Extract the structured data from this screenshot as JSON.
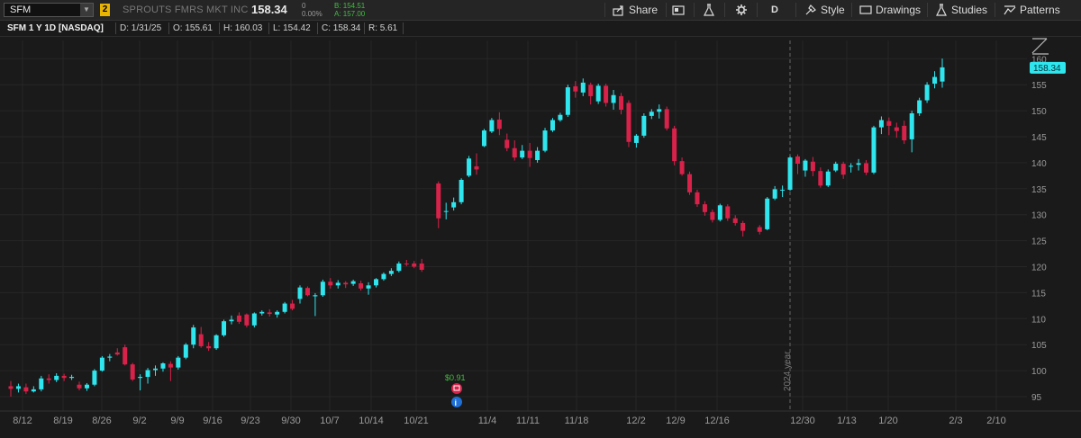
{
  "toolbar": {
    "symbol": "SFM",
    "link_badge": "2",
    "company": "SPROUTS FMRS MKT INC",
    "last_price": "158.34",
    "net_change": "0",
    "pct_change": "0.00%",
    "bid": "B: 154.51",
    "ask": "A: 157.00",
    "share_label": "Share",
    "aggregation_label": "D",
    "style_label": "Style",
    "drawings_label": "Drawings",
    "studies_label": "Studies",
    "patterns_label": "Patterns",
    "icons": [
      "share-icon",
      "snapshot-icon",
      "flask-icon",
      "gear-icon",
      "style-icon",
      "drawings-icon",
      "studies-icon",
      "patterns-icon"
    ]
  },
  "infobar": {
    "title": "SFM 1 Y 1D [NASDAQ]",
    "date": "D: 1/31/25",
    "open": "O: 155.61",
    "high": "H: 160.03",
    "low": "L: 154.42",
    "close": "C: 158.34",
    "range": "R: 5.61"
  },
  "chart_data": {
    "type": "candlestick",
    "y_ticks": [
      "160",
      "155",
      "150",
      "145",
      "140",
      "135",
      "130",
      "125",
      "120",
      "115",
      "110",
      "105",
      "100",
      "95"
    ],
    "ylim": [
      92,
      162
    ],
    "x_ticks": [
      "8/12",
      "8/19",
      "8/26",
      "9/2",
      "9/9",
      "9/16",
      "9/23",
      "9/30",
      "10/7",
      "10/14",
      "10/21",
      "11/4",
      "11/11",
      "11/18",
      "12/2",
      "12/9",
      "12/16",
      "12/30",
      "1/13",
      "1/20",
      "2/3",
      "2/10"
    ],
    "price_label": "158.34",
    "year_marker": "2024 year",
    "dividend_label": "$0.91",
    "colors": {
      "up": "#2fe6ee",
      "down": "#d9224a",
      "grid": "#262626",
      "axis_text": "#9a9a9a",
      "price_tag": "#2fe6ee"
    },
    "candles": [
      [
        97,
        98,
        95,
        96.5
      ],
      [
        96.5,
        97.5,
        95.8,
        97
      ],
      [
        96.8,
        97.5,
        95.5,
        96
      ],
      [
        96,
        97,
        95.8,
        96.4
      ],
      [
        96.4,
        99,
        96,
        98.5
      ],
      [
        98.5,
        99.3,
        97.5,
        98.2
      ],
      [
        98.2,
        99.5,
        97.8,
        99
      ],
      [
        99,
        99.4,
        98,
        98.6
      ],
      [
        98.6,
        99.2,
        98.2,
        98.8
      ],
      [
        97.3,
        97.9,
        96.2,
        96.6
      ],
      [
        96.6,
        97.6,
        96.1,
        97.3
      ],
      [
        97.3,
        100.3,
        97,
        100
      ],
      [
        100,
        102.8,
        99.8,
        102.5
      ],
      [
        102.5,
        103.2,
        101.8,
        102.7
      ],
      [
        103.5,
        104.3,
        102.9,
        103.1
      ],
      [
        104.5,
        105,
        101,
        101.2
      ],
      [
        101.2,
        101.5,
        98,
        98.3
      ],
      [
        98.6,
        99.3,
        96.2,
        98.8
      ],
      [
        98.8,
        100.5,
        97.5,
        100.1
      ],
      [
        100.1,
        101,
        99,
        100.4
      ],
      [
        100.4,
        101.6,
        99.8,
        101.4
      ],
      [
        101.3,
        101.8,
        98,
        100.6
      ],
      [
        100.6,
        102.8,
        100.2,
        102.5
      ],
      [
        102.5,
        105.3,
        102.2,
        105
      ],
      [
        105,
        108.8,
        104.3,
        108.3
      ],
      [
        107,
        108.4,
        104.4,
        104.7
      ],
      [
        104.7,
        105.5,
        103.8,
        104.3
      ],
      [
        104.3,
        107,
        104,
        106.8
      ],
      [
        106.8,
        109.8,
        106.5,
        109.5
      ],
      [
        109.5,
        110.6,
        108.9,
        109.8
      ],
      [
        110.6,
        111.2,
        109,
        109.4
      ],
      [
        110.8,
        111,
        108.3,
        108.7
      ],
      [
        108.7,
        111.2,
        108.3,
        111
      ],
      [
        111,
        111.6,
        110.6,
        111.3
      ],
      [
        111.2,
        111.8,
        110.4,
        110.9
      ],
      [
        110.8,
        111.6,
        110.2,
        111.3
      ],
      [
        111.3,
        113.2,
        111,
        112.9
      ],
      [
        112.9,
        113.6,
        111.6,
        111.9
      ],
      [
        113.8,
        116.4,
        112.9,
        116
      ],
      [
        115.9,
        116.2,
        114.3,
        114.5
      ],
      [
        114.3,
        114.9,
        110.5,
        114.5
      ],
      [
        114.5,
        117.5,
        114.2,
        117.1
      ],
      [
        117.1,
        117.8,
        115.8,
        116.4
      ],
      [
        116.4,
        117.4,
        115.8,
        116.9
      ],
      [
        116.9,
        117.2,
        115.9,
        116.6
      ],
      [
        116.7,
        117.5,
        116.3,
        117.2
      ],
      [
        116.8,
        117.3,
        115.4,
        115.8
      ],
      [
        115.8,
        117,
        114.6,
        116.4
      ],
      [
        116.4,
        117.8,
        116,
        117.6
      ],
      [
        117.6,
        118.9,
        117.3,
        118.6
      ],
      [
        118.6,
        119.7,
        118.2,
        119.2
      ],
      [
        119.2,
        121,
        118.9,
        120.6
      ],
      [
        120.6,
        121.3,
        120.1,
        120.5
      ],
      [
        120.6,
        121.1,
        119.7,
        120
      ],
      [
        120.6,
        121.5,
        119,
        119.4
      ],
      [
        136,
        136.4,
        127.4,
        129.3
      ],
      [
        130.7,
        132.3,
        129.1,
        130.7
      ],
      [
        131.4,
        133.3,
        130.8,
        132.4
      ],
      [
        132.4,
        137,
        132,
        136.7
      ],
      [
        137.5,
        141.3,
        137.2,
        140.8
      ],
      [
        139.3,
        141.8,
        137.7,
        138.7
      ],
      [
        143.2,
        146.5,
        143,
        146.2
      ],
      [
        146,
        148.6,
        145.7,
        148.2
      ],
      [
        148.3,
        149.7,
        145.3,
        146.5
      ],
      [
        144.4,
        145.6,
        142.2,
        142.8
      ],
      [
        142.8,
        144.3,
        140.4,
        141
      ],
      [
        141,
        143.4,
        140.7,
        142.3
      ],
      [
        142.3,
        143.8,
        139.2,
        140.9
      ],
      [
        140.5,
        143,
        140,
        142.3
      ],
      [
        142.3,
        146.7,
        142,
        146.2
      ],
      [
        146.2,
        148.6,
        145.9,
        148.2
      ],
      [
        148.2,
        149.6,
        147.9,
        149.2
      ],
      [
        149.2,
        155,
        148.8,
        154.5
      ],
      [
        154.7,
        155.7,
        152.5,
        153.7
      ],
      [
        153.5,
        156.2,
        152.8,
        155.4
      ],
      [
        155,
        155.4,
        151.2,
        152.8
      ],
      [
        151.8,
        155.2,
        151.3,
        154.8
      ],
      [
        154.8,
        155.2,
        150.8,
        151.5
      ],
      [
        151.5,
        154,
        150.2,
        153
      ],
      [
        152.8,
        153.4,
        149.3,
        150.2
      ],
      [
        151.5,
        152,
        143,
        144
      ],
      [
        143.8,
        145.5,
        142.9,
        145.2
      ],
      [
        145.2,
        149.5,
        144.8,
        149
      ],
      [
        149,
        150.3,
        148.4,
        149.8
      ],
      [
        149.8,
        151.2,
        148.5,
        150.3
      ],
      [
        150.3,
        150.8,
        146.2,
        146.6
      ],
      [
        146.6,
        147.1,
        139.5,
        140.3
      ],
      [
        140.3,
        141,
        137.5,
        137.8
      ],
      [
        137.8,
        138.3,
        133.8,
        134.3
      ],
      [
        134.3,
        134.8,
        131.5,
        132
      ],
      [
        132,
        132.6,
        129.8,
        130.5
      ],
      [
        130.5,
        131,
        128.5,
        129
      ],
      [
        129,
        132.1,
        128.7,
        131.8
      ],
      [
        131.6,
        132,
        128.8,
        129.3
      ],
      [
        129.3,
        129.9,
        127.9,
        128.4
      ],
      [
        128.4,
        128.8,
        125.8,
        126.9
      ],
      [
        127.6,
        128,
        126.2,
        126.7
      ],
      [
        127.2,
        133.4,
        127,
        133.1
      ],
      [
        133.1,
        135.5,
        132.8,
        134.9
      ],
      [
        134.8,
        135.6,
        133.4,
        134.8
      ],
      [
        134.8,
        141.3,
        134.6,
        141
      ],
      [
        141.2,
        141.6,
        137.8,
        139.8
      ],
      [
        138.5,
        140.7,
        137.3,
        140.4
      ],
      [
        140.2,
        141.1,
        137.4,
        138.4
      ],
      [
        138.4,
        139.1,
        135.2,
        135.6
      ],
      [
        135.6,
        138.7,
        135.3,
        138.3
      ],
      [
        138.5,
        140.2,
        138.2,
        139.8
      ],
      [
        139.8,
        140.2,
        136.9,
        137.7
      ],
      [
        139.4,
        139.9,
        138.1,
        139.4
      ],
      [
        139.6,
        140.7,
        138.5,
        139.9
      ],
      [
        139.9,
        140.5,
        137.6,
        138.1
      ],
      [
        138.1,
        147.1,
        137.8,
        146.8
      ],
      [
        146.8,
        148.9,
        145.5,
        148.2
      ],
      [
        148,
        148.7,
        145.3,
        147.1
      ],
      [
        146.8,
        147.7,
        144.8,
        146.1
      ],
      [
        147.1,
        148.1,
        143.6,
        144.3
      ],
      [
        144.5,
        150,
        142,
        149.5
      ],
      [
        149.5,
        152.5,
        149,
        152
      ],
      [
        152,
        155.5,
        151.5,
        155
      ],
      [
        155.2,
        157.6,
        154.3,
        156.5
      ],
      [
        155.61,
        160.03,
        154.42,
        158.34
      ]
    ]
  }
}
